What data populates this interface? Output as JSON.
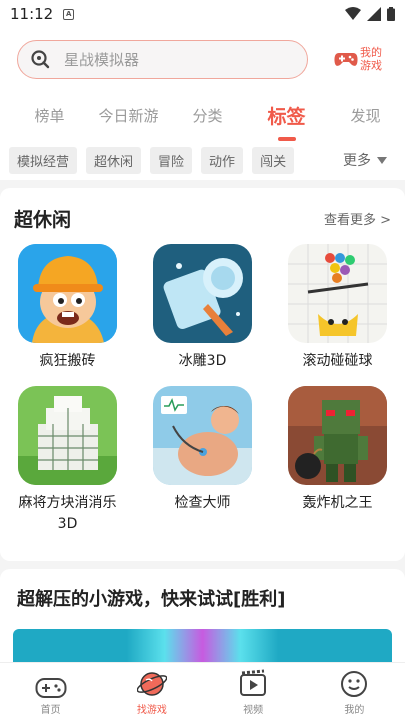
{
  "status": {
    "time": "11:12",
    "sim": "A"
  },
  "search": {
    "placeholder": "星战模拟器"
  },
  "mygames": {
    "label": "我的游戏"
  },
  "tabs": [
    {
      "label": "榜单"
    },
    {
      "label": "今日新游"
    },
    {
      "label": "分类"
    },
    {
      "label": "标签",
      "active": true
    },
    {
      "label": "发现"
    }
  ],
  "chips": [
    {
      "label": "模拟经营"
    },
    {
      "label": "超休闲"
    },
    {
      "label": "冒险"
    },
    {
      "label": "动作"
    },
    {
      "label": "闯关"
    }
  ],
  "more_label": "更多",
  "section": {
    "title": "超休闲",
    "see_more": "查看更多 >",
    "games": [
      {
        "name": "疯狂搬砖",
        "icon": "worker-icon"
      },
      {
        "name": "冰雕3D",
        "icon": "ice-carving-icon"
      },
      {
        "name": "滚动碰碰球",
        "icon": "ball-maze-icon"
      },
      {
        "name": "麻将方块消消乐3D",
        "icon": "mahjong-tower-icon"
      },
      {
        "name": "检查大师",
        "icon": "doctor-check-icon"
      },
      {
        "name": "轰炸机之王",
        "icon": "bomber-icon"
      }
    ]
  },
  "section2": {
    "title": "超解压的小游戏，快来试试[胜利]"
  },
  "nav": [
    {
      "label": "首页",
      "icon": "gamepad-icon"
    },
    {
      "label": "找游戏",
      "icon": "planet-icon",
      "active": true
    },
    {
      "label": "视频",
      "icon": "video-icon"
    },
    {
      "label": "我的",
      "icon": "smiley-icon"
    }
  ],
  "colors": {
    "accent": "#f05a4a"
  }
}
